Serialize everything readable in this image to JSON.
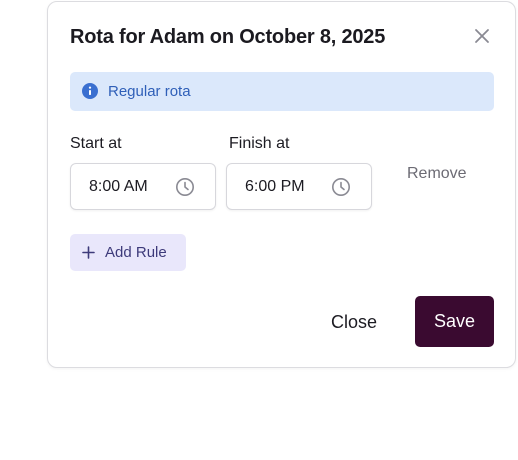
{
  "dialog": {
    "title": "Rota for Adam on October 8, 2025",
    "close_icon": "close-icon"
  },
  "banner": {
    "icon": "info-icon",
    "text": "Regular rota",
    "color": "#2f5fb8",
    "background": "#dbe8fb"
  },
  "rule": {
    "start_label": "Start at",
    "start_value": "8:00 AM",
    "finish_label": "Finish at",
    "finish_value": "6:00 PM",
    "time_icon": "clock-icon",
    "remove_label": "Remove"
  },
  "add_rule": {
    "icon": "plus-icon",
    "label": "Add Rule"
  },
  "footer": {
    "close_label": "Close",
    "save_label": "Save",
    "save_color": "#3a0a30"
  }
}
